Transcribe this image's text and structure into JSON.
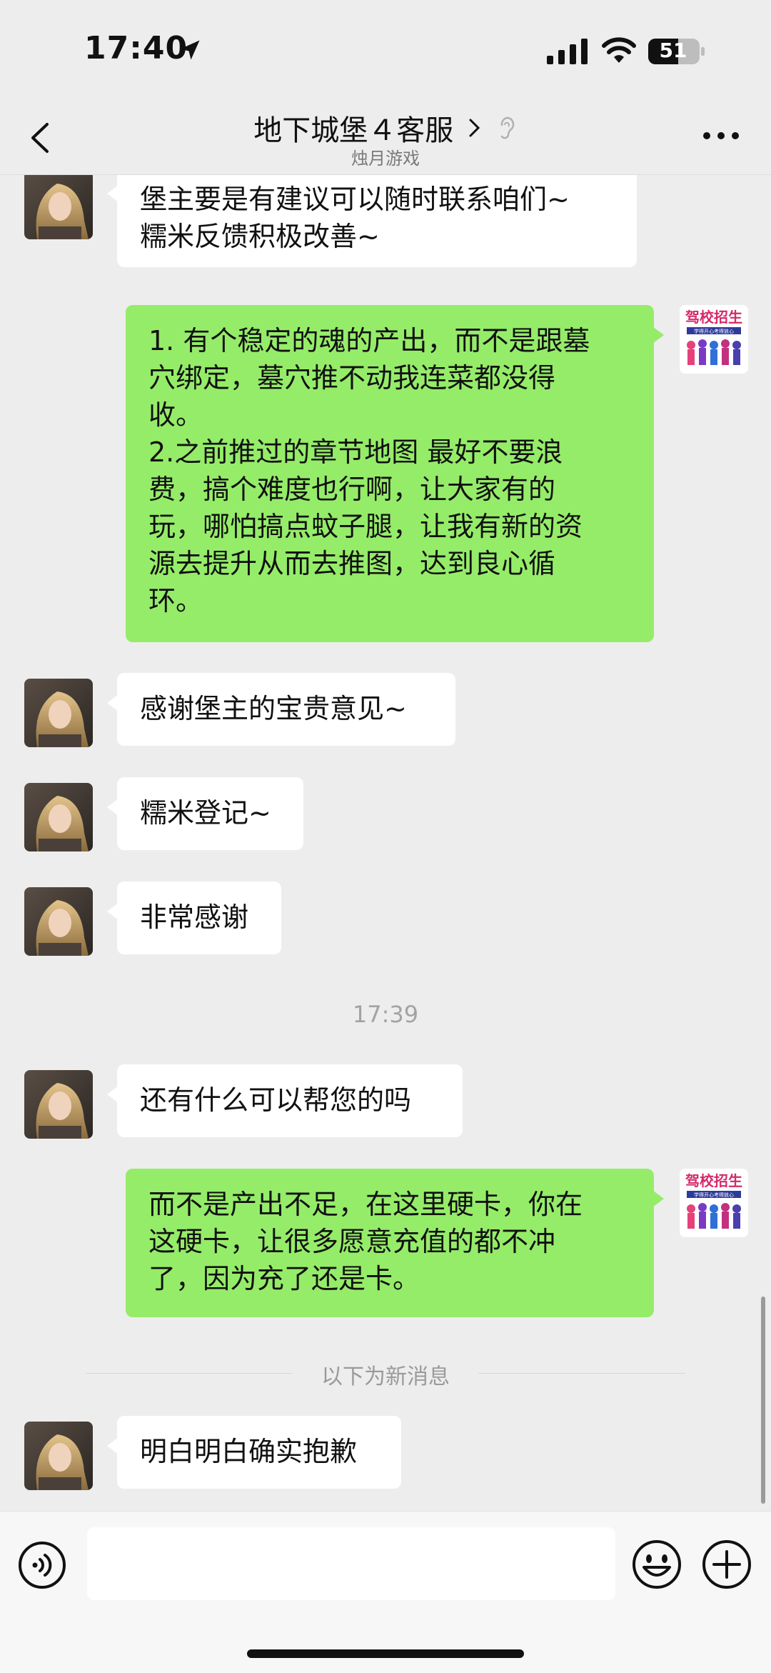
{
  "status_bar": {
    "time": "17:40",
    "battery": "51"
  },
  "nav": {
    "title": "地下城堡４客服",
    "subtitle": "烛月游戏"
  },
  "messages": [
    {
      "side": "left",
      "lines": [
        "堡主要是有建议可以随时联系咱们~",
        "糯米反馈积极改善~"
      ]
    },
    {
      "side": "right",
      "lines": [
        "1. 有个稳定的魂的产出，而不是跟墓",
        "穴绑定，墓穴推不动我连菜都没得",
        "收。",
        "2.之前推过的章节地图 最好不要浪",
        "费，搞个难度也行啊，让大家有的",
        "玩，哪怕搞点蚊子腿，让我有新的资",
        "源去提升从而去推图，达到良心循",
        "环。"
      ]
    },
    {
      "side": "left",
      "lines": [
        "感谢堡主的宝贵意见~"
      ]
    },
    {
      "side": "left",
      "lines": [
        "糯米登记~"
      ]
    },
    {
      "side": "left",
      "lines": [
        "非常感谢"
      ]
    },
    {
      "side": "left",
      "lines": [
        "还有什么可以帮您的吗"
      ]
    },
    {
      "side": "right",
      "lines": [
        "而不是产出不足，在这里硬卡，你在",
        "这硬卡，让很多愿意充值的都不冲",
        "了，因为充了还是卡。"
      ]
    },
    {
      "side": "left",
      "lines": [
        "明白明白确实抱歉"
      ]
    }
  ],
  "timestamp": "17:39",
  "new_messages_divider": "以下为新消息",
  "user_avatar_text": {
    "line1": "驾校招生",
    "line2": "学得开心考得放心"
  }
}
